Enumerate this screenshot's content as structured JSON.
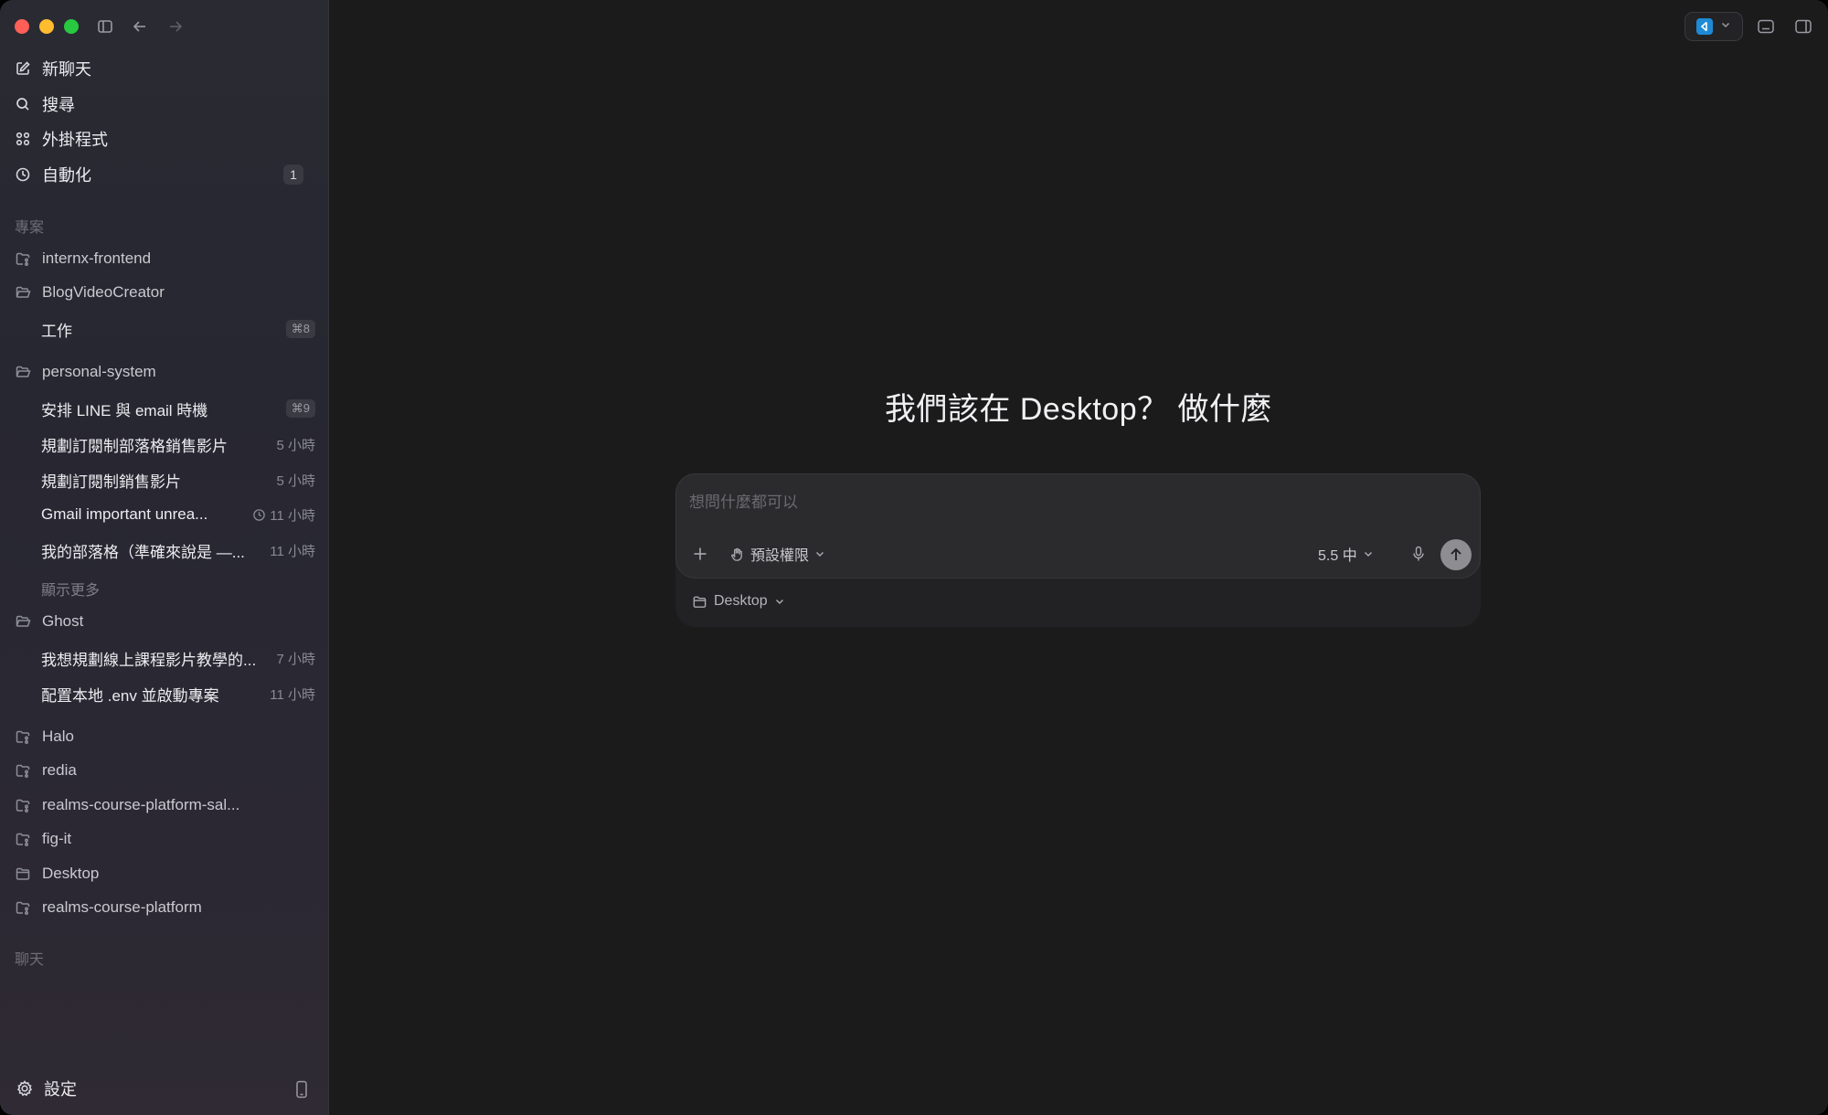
{
  "sidebar": {
    "nav": [
      {
        "label": "新聊天",
        "icon": "edit-icon"
      },
      {
        "label": "搜尋",
        "icon": "search-icon"
      },
      {
        "label": "外掛程式",
        "icon": "grid-icon"
      },
      {
        "label": "自動化",
        "icon": "clock-icon",
        "badge": "1"
      }
    ],
    "projects_title": "專案",
    "projects": [
      {
        "name": "internx-frontend"
      },
      {
        "name": "BlogVideoCreator",
        "threads": [
          {
            "title": "工作",
            "shortcut": "⌘8"
          }
        ]
      },
      {
        "name": "personal-system",
        "threads": [
          {
            "title": "安排 LINE 與 email 時機",
            "shortcut": "⌘9"
          },
          {
            "title": "規劃訂閱制部落格銷售影片",
            "time": "5 小時"
          },
          {
            "title": "規劃訂閱制銷售影片",
            "time": "5 小時"
          },
          {
            "title": "Gmail important unrea...",
            "time": "11 小時"
          },
          {
            "title": "我的部落格（準確來說是 —...",
            "time": "11 小時"
          }
        ],
        "show_more": "顯示更多"
      },
      {
        "name": "Ghost",
        "threads": [
          {
            "title": "我想規劃線上課程影片教學的...",
            "time": "7 小時"
          },
          {
            "title": "配置本地 .env 並啟動專案",
            "time": "11 小時"
          }
        ]
      },
      {
        "name": "Halo"
      },
      {
        "name": "redia"
      },
      {
        "name": "realms-course-platform-sal..."
      },
      {
        "name": "fig-it"
      },
      {
        "name": "Desktop"
      },
      {
        "name": "realms-course-platform"
      }
    ],
    "chats_title": "聊天",
    "settings_label": "設定"
  },
  "main": {
    "headline": "我們該在 Desktop？ 做什麼",
    "composer": {
      "placeholder": "想問什麼都可以",
      "permissions_label": "預設權限",
      "model_label": "5.5 中",
      "folder_label": "Desktop"
    }
  }
}
